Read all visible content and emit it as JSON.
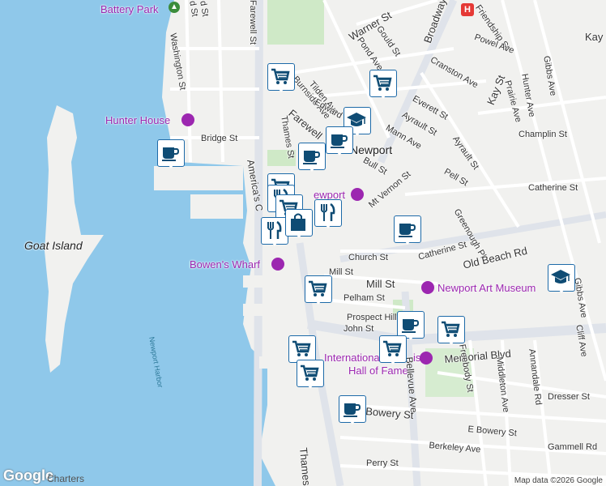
{
  "map": {
    "colors": {
      "water": "#8fc8ea",
      "land": "#f1f1ef",
      "road": "#ffffff",
      "major_road": "#e0e4ea",
      "park": "#cfe9c7",
      "marker_fg": "#0f4c74"
    },
    "labels": {
      "battery_park": "Battery Park",
      "hunter_house": "Hunter House",
      "goat_island": "Goat Island",
      "bowens_wharf": "Bowen's Wharf",
      "newport": "Newport",
      "newport_art_museum": "Newport Art Museum",
      "intl_hall_a": "International T",
      "intl_hall_b": "is",
      "intl_hall_c": "Hall of Fame",
      "newport_harbor": "Newport Harbor",
      "charters": "Charters",
      "newport_partial": "ewport"
    },
    "streets": {
      "washington": "Washington St",
      "farewell_top": "Farewell St",
      "farewell_mid": "Farewell",
      "warner": "Warner St",
      "gould": "Gould St",
      "pond": "Pond Ave",
      "broadway": "Broadway",
      "friendship": "Friendship St",
      "powel": "Powel Ave",
      "kay_top": "Kay",
      "cranston": "Cranston Ave",
      "kay": "Kay St",
      "gibbs": "Gibbs Ave",
      "hunter": "Hunter Ave",
      "prairie": "Prairie Ave",
      "burnside": "Burnside Ave",
      "tilden": "Tilden Ave",
      "edward": "Edward",
      "everett": "Everett St",
      "ayrault": "Ayrault St",
      "mann": "Mann Ave",
      "ayrault2": "Ayrault St",
      "champlin": "Champlin St",
      "bridge": "Bridge St",
      "thames": "Thames St",
      "bull": "Bull St",
      "pell": "Pell St",
      "mt_vernon": "Mt Vernon St",
      "catherine": "Catherine St",
      "catherine2": "Catherine St",
      "greenough": "Greenough Pl",
      "americas": "America's C",
      "church": "Church St",
      "old_beach": "Old Beach Rd",
      "mill": "Mill St",
      "mill2": "Mill St",
      "pelham": "Pelham St",
      "prospect": "Prospect Hill",
      "john": "John St",
      "memorial": "Memorial Blvd",
      "gibbs2": "Gibbs Ave",
      "bellevue": "Bellevue Ave",
      "freebody": "Freebody St",
      "middleton": "Middleton Ave",
      "annandale": "Annandale Rd",
      "cliff": "Cliff Ave",
      "dresser": "Dresser St",
      "bowery": "Bowery St",
      "e_bowery": "E Bowery St",
      "berkeley": "Berkeley Ave",
      "gammell": "Gammell Rd",
      "perry": "Perry St",
      "thames2": "Thames",
      "std": "d St",
      "d_st": "d St"
    },
    "markers": [
      {
        "icon": "cart-icon"
      },
      {
        "icon": "cart-icon"
      },
      {
        "icon": "school-icon"
      },
      {
        "icon": "coffee-icon"
      },
      {
        "icon": "coffee-icon"
      },
      {
        "icon": "coffee-icon"
      },
      {
        "icon": "cart-icon"
      },
      {
        "icon": "restaurant-icon"
      },
      {
        "icon": "cart-icon"
      },
      {
        "icon": "restaurant-icon"
      },
      {
        "icon": "restaurant-icon"
      },
      {
        "icon": "shopping-bag-icon"
      },
      {
        "icon": "coffee-icon"
      },
      {
        "icon": "school-icon"
      },
      {
        "icon": "cart-icon"
      },
      {
        "icon": "coffee-icon"
      },
      {
        "icon": "cart-icon"
      },
      {
        "icon": "cart-icon"
      },
      {
        "icon": "cart-icon"
      },
      {
        "icon": "cart-icon"
      },
      {
        "icon": "coffee-icon"
      }
    ],
    "google_logo": "Google",
    "attribution": "Map data ©2026 Google"
  }
}
